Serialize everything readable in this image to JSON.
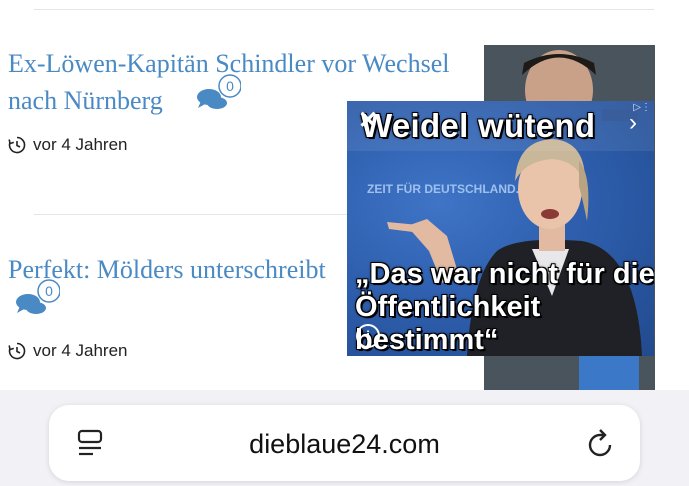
{
  "articles": [
    {
      "title_line1": "Ex-Löwen-Kapitän Schindler vor Wechsel",
      "title_line2": "nach Nürnberg",
      "comment_count": "0",
      "time": "vor 4 Jahren"
    },
    {
      "title_line1": "Perfekt: Mölders unterschreibt",
      "comment_count": "0",
      "time": "vor 4 Jahren"
    }
  ],
  "ad": {
    "title": "Weidel wütend",
    "quote": "„Das war nicht für die Öffentlichkeit bestimmt“",
    "poster_text": "ZEIT FÜR DEUTSCHLAND."
  },
  "browser": {
    "url": "dieblaue24.com"
  },
  "colors": {
    "link": "#4a8ac4",
    "ad_blue": "#2d5aa8"
  }
}
